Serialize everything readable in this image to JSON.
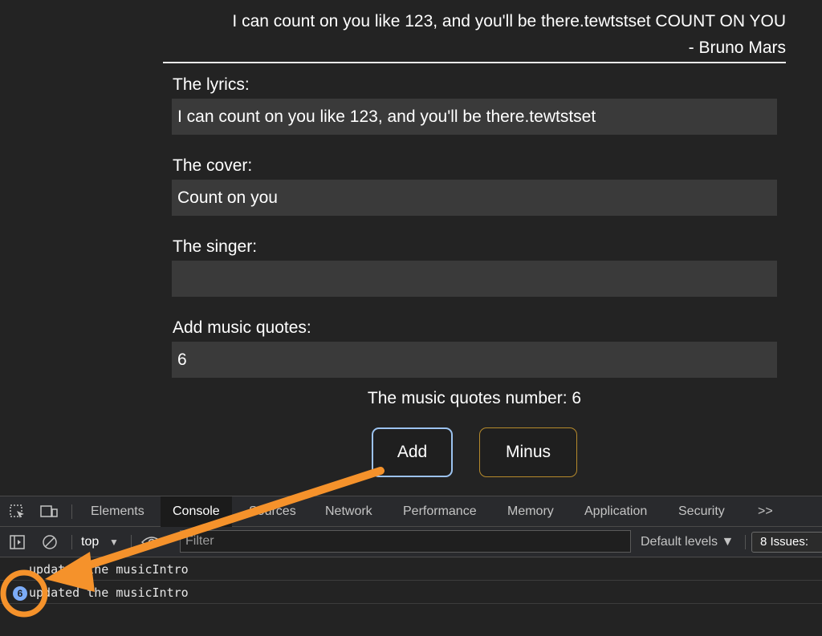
{
  "quote": {
    "text": "I can count on you like 123, and you'll be there.tewtstset COUNT ON YOU",
    "author": "- Bruno Mars"
  },
  "form": {
    "lyrics_label": "The lyrics:",
    "lyrics_value": "I can count on you like 123, and you'll be there.tewtstset",
    "cover_label": "The cover:",
    "cover_value": "Count on you",
    "singer_label": "The singer:",
    "singer_value": "",
    "quotes_label": "Add music quotes:",
    "quotes_value": "6"
  },
  "count_text": "The music quotes number: 6",
  "buttons": {
    "add": "Add",
    "minus": "Minus"
  },
  "devtools": {
    "tabs": [
      "Elements",
      "Console",
      "Sources",
      "Network",
      "Performance",
      "Memory",
      "Application",
      "Security"
    ],
    "active_tab": "Console",
    "more_tabs": ">>",
    "context": "top",
    "context_arrow": "▼",
    "filter_placeholder": "Filter",
    "levels": "Default levels ▼",
    "issues": "8 Issues:",
    "logs": [
      {
        "text": "updated the musicIntro",
        "count": ""
      },
      {
        "text": "updated the musicIntro",
        "count": "6"
      }
    ]
  },
  "colors": {
    "add_border": "#9cc3f0",
    "minus_border": "#b68a2c",
    "annotation": "#f5922b",
    "badge": "#7cacf8"
  }
}
